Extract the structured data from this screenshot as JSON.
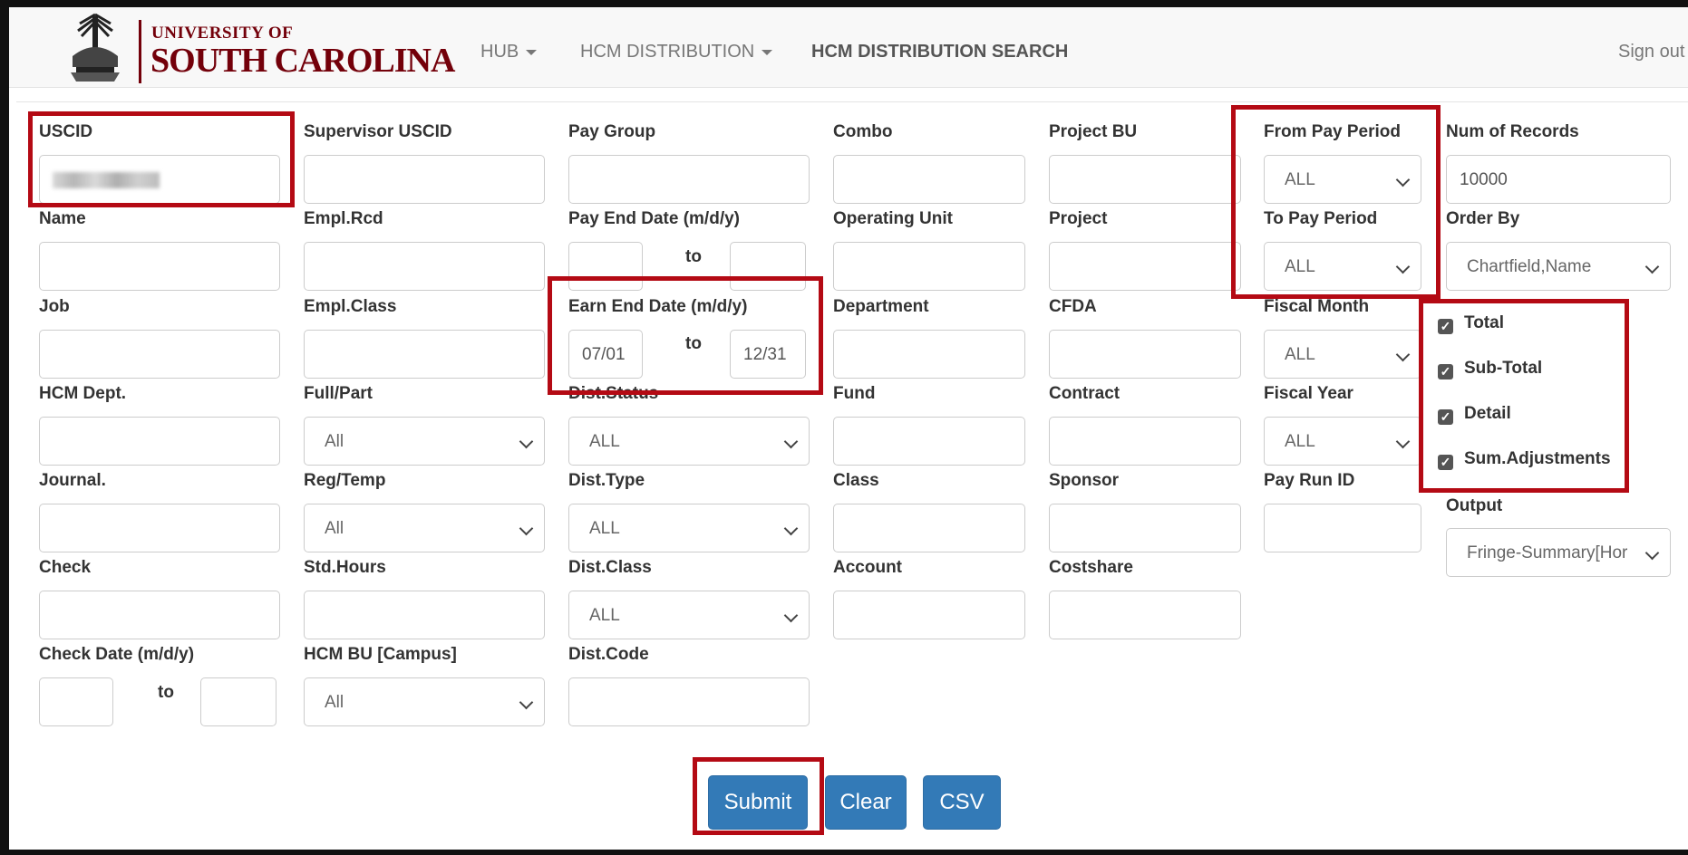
{
  "nav": {
    "logo": {
      "line1": "UNIVERSITY OF",
      "line2": "SOUTH CAROLINA"
    },
    "items": [
      {
        "label": "HUB",
        "has_caret": true
      },
      {
        "label": "HCM DISTRIBUTION",
        "has_caret": true
      },
      {
        "label": "HCM DISTRIBUTION SEARCH",
        "active": true
      }
    ],
    "sign_out": "Sign out"
  },
  "form": {
    "uscid": {
      "label": "USCID",
      "value_redacted": true
    },
    "supervisor_uscid": {
      "label": "Supervisor USCID",
      "value": ""
    },
    "pay_group": {
      "label": "Pay Group",
      "value": ""
    },
    "combo": {
      "label": "Combo",
      "value": ""
    },
    "project_bu": {
      "label": "Project BU",
      "value": ""
    },
    "from_pay_period": {
      "label": "From Pay Period",
      "value": "ALL"
    },
    "num_records": {
      "label": "Num of Records",
      "value": "10000"
    },
    "name": {
      "label": "Name",
      "value": ""
    },
    "empl_rcd": {
      "label": "Empl.Rcd",
      "value": ""
    },
    "pay_end_date": {
      "label": "Pay End Date (m/d/y)",
      "to": "to",
      "from_value": "",
      "to_value": ""
    },
    "operating_unit": {
      "label": "Operating Unit",
      "value": ""
    },
    "project": {
      "label": "Project",
      "value": ""
    },
    "to_pay_period": {
      "label": "To Pay Period",
      "value": "ALL"
    },
    "order_by": {
      "label": "Order By",
      "value": "Chartfield,Name"
    },
    "job": {
      "label": "Job",
      "value": ""
    },
    "empl_class": {
      "label": "Empl.Class",
      "value": ""
    },
    "earn_end_date": {
      "label": "Earn End Date (m/d/y)",
      "to": "to",
      "from_value": "07/01",
      "to_value": "12/31"
    },
    "department": {
      "label": "Department",
      "value": ""
    },
    "cfda": {
      "label": "CFDA",
      "value": ""
    },
    "fiscal_month": {
      "label": "Fiscal Month",
      "value": "ALL"
    },
    "hcm_dept": {
      "label": "HCM Dept.",
      "value": ""
    },
    "full_part": {
      "label": "Full/Part",
      "value": "All"
    },
    "dist_status": {
      "label": "Dist.Status",
      "value": "ALL"
    },
    "fund": {
      "label": "Fund",
      "value": ""
    },
    "contract": {
      "label": "Contract",
      "value": ""
    },
    "fiscal_year": {
      "label": "Fiscal Year",
      "value": "ALL"
    },
    "journal": {
      "label": "Journal.",
      "value": ""
    },
    "reg_temp": {
      "label": "Reg/Temp",
      "value": "All"
    },
    "dist_type": {
      "label": "Dist.Type",
      "value": "ALL"
    },
    "class": {
      "label": "Class",
      "value": ""
    },
    "sponsor": {
      "label": "Sponsor",
      "value": ""
    },
    "pay_run_id": {
      "label": "Pay Run ID",
      "value": ""
    },
    "output": {
      "label": "Output",
      "value": "Fringe-Summary[Hor"
    },
    "check": {
      "label": "Check",
      "value": ""
    },
    "std_hours": {
      "label": "Std.Hours",
      "value": ""
    },
    "dist_class": {
      "label": "Dist.Class",
      "value": "ALL"
    },
    "account": {
      "label": "Account",
      "value": ""
    },
    "costshare": {
      "label": "Costshare",
      "value": ""
    },
    "check_date": {
      "label": "Check Date (m/d/y)",
      "to": "to",
      "from_value": "",
      "to_value": ""
    },
    "hcm_bu": {
      "label": "HCM BU [Campus]",
      "value": "All"
    },
    "dist_code": {
      "label": "Dist.Code",
      "value": ""
    },
    "checkboxes": [
      {
        "label": "Total",
        "checked": true
      },
      {
        "label": "Sub-Total",
        "checked": true
      },
      {
        "label": "Detail",
        "checked": true
      },
      {
        "label": "Sum.Adjustments",
        "checked": true
      }
    ]
  },
  "buttons": {
    "submit": "Submit",
    "clear": "Clear",
    "csv": "CSV"
  },
  "colors": {
    "brand": "#73000a",
    "primary_button": "#337ab7",
    "highlight": "#b40a14"
  }
}
